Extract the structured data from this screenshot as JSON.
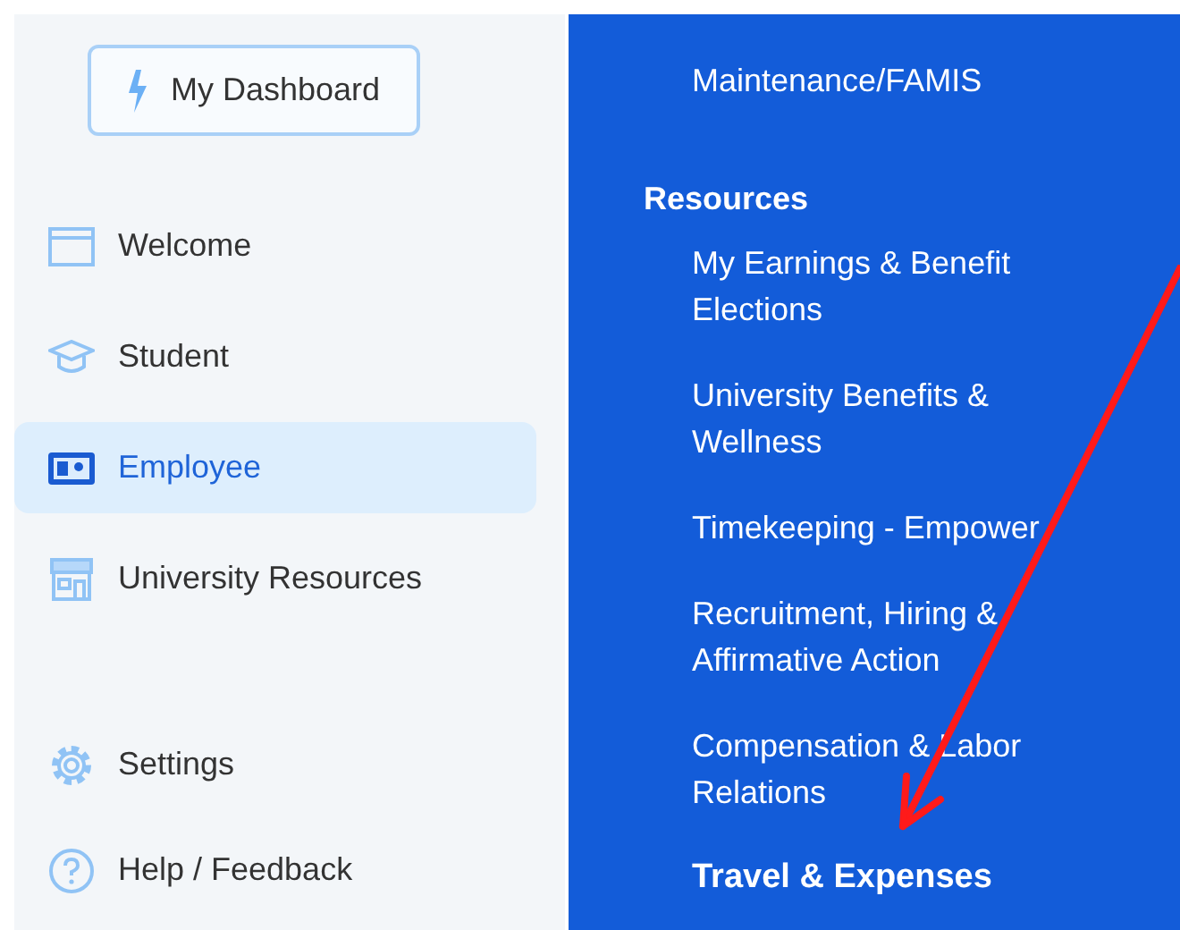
{
  "sidebar": {
    "dashboard_button": "My Dashboard",
    "items": [
      {
        "label": "Welcome",
        "selected": false
      },
      {
        "label": "Student",
        "selected": false
      },
      {
        "label": "Employee",
        "selected": true
      },
      {
        "label": "University Resources",
        "selected": false
      }
    ],
    "footer_items": [
      {
        "label": "Settings"
      },
      {
        "label": "Help / Feedback"
      }
    ]
  },
  "menu": {
    "top_link": "Maintenance/FAMIS",
    "section": "Resources",
    "links": [
      {
        "label": "My Earnings & Benefit Elections",
        "selected": false
      },
      {
        "label": "University Benefits & Wellness",
        "selected": false
      },
      {
        "label": "Timekeeping - Empower",
        "selected": false
      },
      {
        "label": "Recruitment, Hiring & Affirmative Action",
        "selected": false
      },
      {
        "label": "Compensation & Labor Relations",
        "selected": false
      },
      {
        "label": "Travel & Expenses",
        "selected": true
      }
    ]
  }
}
